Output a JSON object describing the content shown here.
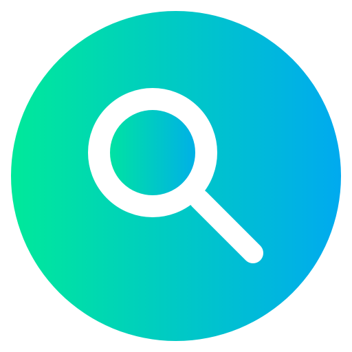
{
  "icon": {
    "name": "search-icon",
    "gradient_start": "#00E99A",
    "gradient_end": "#00AAEF",
    "glyph_color": "#FFFFFF"
  }
}
